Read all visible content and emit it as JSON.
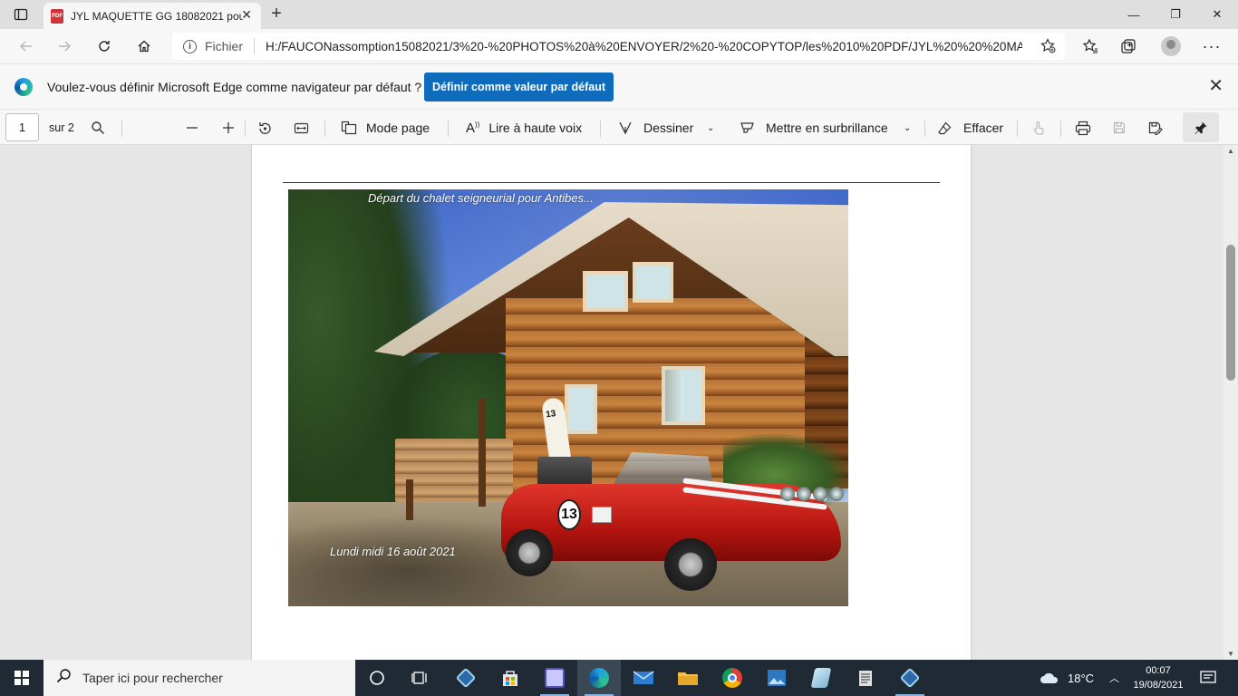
{
  "browser": {
    "tab_title": "JYL MAQUETTE GG 18082021 pour",
    "tab_close": "✕",
    "new_tab": "+",
    "scheme_label": "Fichier",
    "url": "H:/FAUCONassomption15082021/3%20-%20PHOTOS%20à%20ENVOYER/2%20-%20COPYTOP/les%2010%20PDF/JYL%20%20%20MA...",
    "window_controls": {
      "minimize": "—",
      "restore": "❐",
      "close": "✕"
    }
  },
  "infobar": {
    "message": "Voulez-vous définir Microsoft Edge comme navigateur par défaut ?",
    "button_label": "Définir comme valeur par défaut",
    "close": "✕"
  },
  "pdf_toolbar": {
    "page_number": "1",
    "page_total": "sur 2",
    "page_mode": "Mode page",
    "read_aloud": "Lire à haute voix",
    "draw": "Dessiner",
    "highlight": "Mettre en surbrillance",
    "erase": "Effacer"
  },
  "document": {
    "caption_top": "Départ du chalet seigneurial pour Antibes...",
    "caption_bottom": "Lundi midi 16 août 2021",
    "car_number": "13"
  },
  "taskbar": {
    "search_placeholder": "Taper ici pour rechercher",
    "weather": "18°C",
    "time": "00:07",
    "date": "19/08/2021"
  },
  "colors": {
    "accent_button": "#0f6cbd",
    "taskbar_bg": "#1f2a35",
    "pdf_tab_icon": "#d13438"
  },
  "icons": {
    "tab_actions": "tab-actions-icon",
    "back": "back-arrow-icon",
    "forward": "forward-arrow-icon",
    "refresh": "refresh-icon",
    "home": "home-icon",
    "favorites": "favorites-icon",
    "collections": "collections-icon",
    "settings": "more-icon"
  }
}
